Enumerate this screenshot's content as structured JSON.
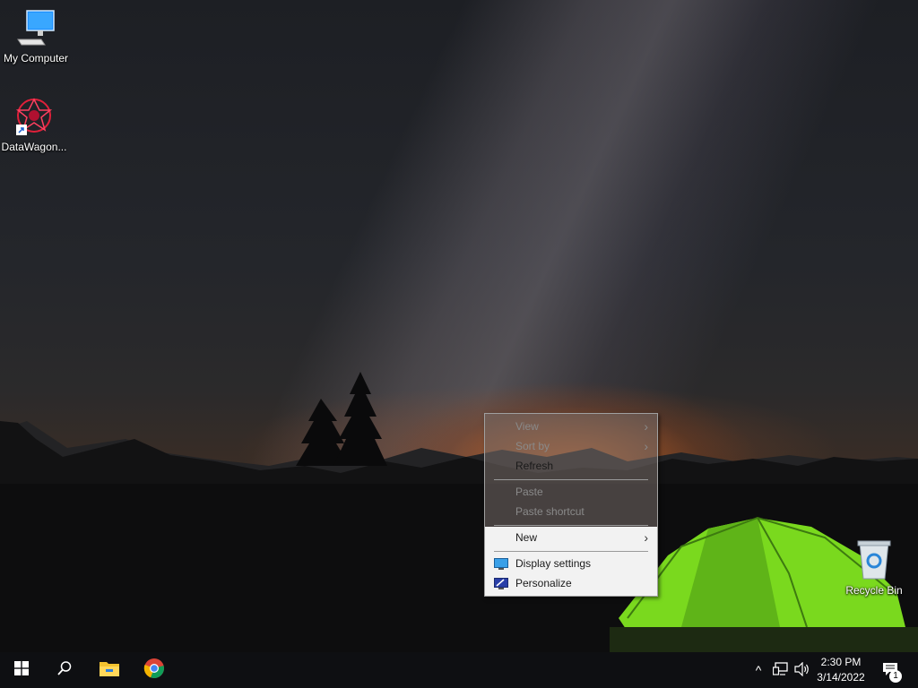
{
  "desktop": {
    "icons": [
      {
        "label": "My Computer",
        "icon": "computer-icon"
      },
      {
        "label": "DataWagon...",
        "icon": "datawagon-app-icon"
      },
      {
        "label": "Recycle Bin",
        "icon": "recycle-bin-icon"
      }
    ]
  },
  "context_menu": {
    "items": [
      {
        "label": "View",
        "enabled": false,
        "submenu": true
      },
      {
        "label": "Sort by",
        "enabled": false,
        "submenu": true
      },
      {
        "label": "Refresh",
        "enabled": true,
        "submenu": false
      },
      {
        "label": "Paste",
        "enabled": false,
        "submenu": false
      },
      {
        "label": "Paste shortcut",
        "enabled": false,
        "submenu": false
      },
      {
        "label": "New",
        "enabled": true,
        "submenu": true
      },
      {
        "label": "Display settings",
        "enabled": true,
        "icon": "display-settings-icon"
      },
      {
        "label": "Personalize",
        "enabled": true,
        "icon": "personalize-icon"
      }
    ],
    "submenu_arrow": "›"
  },
  "taskbar": {
    "start_icon": "windows-start-icon",
    "search_icon": "search-icon",
    "pinned": [
      "file-explorer-icon",
      "chrome-icon"
    ],
    "tray": {
      "chevron": "^",
      "network_icon": "network-icon",
      "volume_icon": "volume-icon",
      "time": "2:30 PM",
      "date": "3/14/2022",
      "notifications_icon": "action-center-icon",
      "notification_count": "1"
    }
  },
  "colors": {
    "taskbar_bg": "#0e0f12",
    "tent_green": "#7ad91e",
    "horizon_orange": "#d86a28"
  }
}
